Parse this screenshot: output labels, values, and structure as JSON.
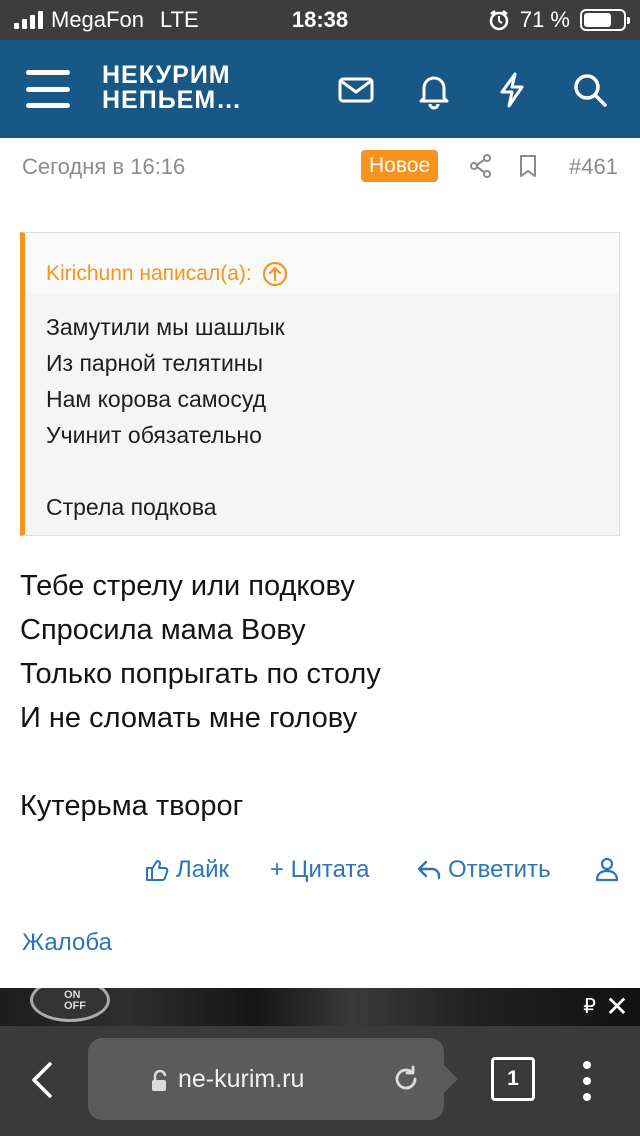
{
  "status_bar": {
    "carrier": "MegaFon",
    "network": "LTE",
    "time": "18:38",
    "battery": "71 %",
    "battery_level": 0.71
  },
  "header": {
    "logo_line1": "НЕКУРИМ",
    "logo_line2": "НЕПЬЕМ…",
    "icons": [
      "inbox-icon",
      "bell-icon",
      "lightning-icon",
      "search-icon"
    ],
    "color": "#185886"
  },
  "post_meta": {
    "date": "Сегодня в 16:16",
    "new_badge": "Новое",
    "post_number": "#461",
    "accent": "#f7931e"
  },
  "quote": {
    "author": "Kirichunn написал(а):",
    "lines": [
      "Замутили мы шашлык",
      "Из парной телятины",
      "Нам корова самосуд",
      "Учинит обязательно",
      "",
      "Стрела подкова"
    ]
  },
  "post": {
    "lines": [
      "Тебе стрелу или подкову",
      "Спросила мама Вову",
      "Только попрыгать по столу",
      "И не сломать мне голову",
      "",
      "Кутерьма творог"
    ]
  },
  "actions": {
    "like": "Лайк",
    "quote": "+ Цитата",
    "reply": "Ответить",
    "report": "Жалоба",
    "link_color": "#2c75b8"
  },
  "ad": {
    "knob_line1": "ON",
    "knob_line2": "OFF",
    "currency": "₽",
    "close": "✕"
  },
  "browser": {
    "url": "ne-kurim.ru",
    "tab_count": "1"
  }
}
